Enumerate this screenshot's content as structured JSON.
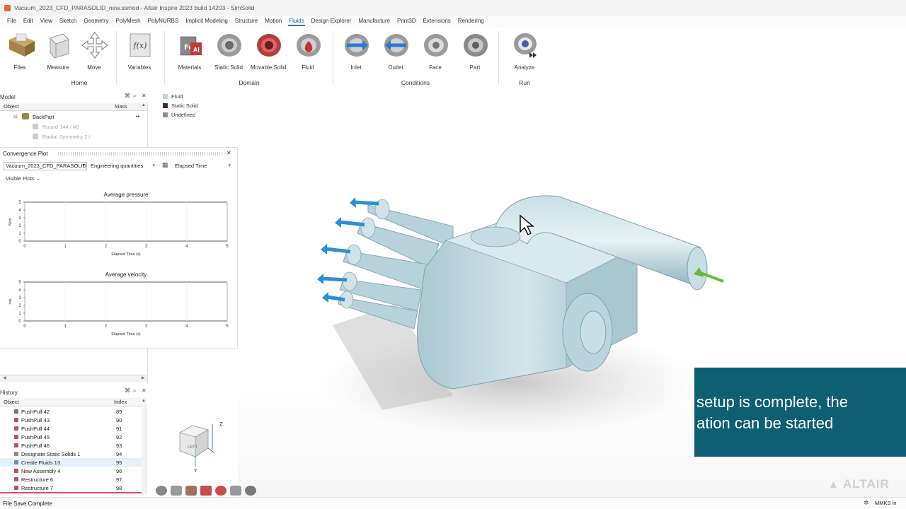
{
  "window": {
    "title": "Vacuum_2023_CFD_PARASOLID_new.ssmod - Altair Inspire 2023 build 14203 - SimSolid"
  },
  "menu": [
    "File",
    "Edit",
    "View",
    "Sketch",
    "Geometry",
    "PolyMesh",
    "PolyNURBS",
    "Implicit Modeling",
    "Structure",
    "Motion",
    "Fluids",
    "Design Explorer",
    "Manufacture",
    "Print3D",
    "Extensions",
    "Rendering"
  ],
  "ribbon": {
    "tools": {
      "files": "Files",
      "measure": "Measure",
      "move": "Move",
      "variables": "Variables",
      "materials": "Materials",
      "static_solid": "Static Solid",
      "movable_solid": "Movable Solid",
      "fluid": "Fluid",
      "inlet": "Inlet",
      "outlet": "Outlet",
      "face": "Face",
      "part": "Part",
      "analyze": "Analyze"
    },
    "groups": {
      "home": "Home",
      "domain": "Domain",
      "conditions": "Conditions",
      "run": "Run"
    }
  },
  "model_panel": {
    "title": "Model",
    "col_object": "Object",
    "col_mass": "Mass",
    "items": [
      "BackPart",
      "Round 144 / #0",
      "Radial Symmetry 2 /"
    ]
  },
  "legend": [
    {
      "label": "Fluid",
      "color": "#bcd6e4"
    },
    {
      "label": "Static Solid",
      "color": "#333333"
    },
    {
      "label": "Undefined",
      "color": "#8e8e8e"
    }
  ],
  "convergence": {
    "title": "Convergence Plot",
    "study": "Vacuum_2023_CFD_PARASOLID",
    "quantities": "Engineering quantities",
    "time": "Elapsed Time",
    "visible_plots": "Visible Plots"
  },
  "chart_data": [
    {
      "type": "line",
      "title": "Average pressure",
      "xlabel": "Elapsed Time (s)",
      "ylabel": "N/m²",
      "xlim": [
        0,
        5
      ],
      "ylim": [
        0,
        5
      ],
      "x_ticks": [
        "0",
        "1",
        "2",
        "3",
        "4",
        "5"
      ],
      "y_ticks": [
        "0",
        "1",
        "2",
        "3",
        "4",
        "5"
      ],
      "series": []
    },
    {
      "type": "line",
      "title": "Average velocity",
      "xlabel": "Elapsed Time (s)",
      "ylabel": "m/s",
      "xlim": [
        0,
        5
      ],
      "ylim": [
        0,
        5
      ],
      "x_ticks": [
        "0",
        "1",
        "2",
        "3",
        "4",
        "5"
      ],
      "y_ticks": [
        "0",
        "1",
        "2",
        "3",
        "4",
        "5"
      ],
      "series": []
    }
  ],
  "history": {
    "title": "History",
    "col_object": "Object",
    "col_index": "Index",
    "rows": [
      {
        "name": "PushPull 42",
        "index": "89"
      },
      {
        "name": "PushPull 43",
        "index": "90"
      },
      {
        "name": "PushPull 44",
        "index": "91"
      },
      {
        "name": "PushPull 45",
        "index": "92"
      },
      {
        "name": "PushPull 46",
        "index": "93"
      },
      {
        "name": "Designate Static Solids 1",
        "index": "94"
      },
      {
        "name": "Create Fluids 13",
        "index": "95"
      },
      {
        "name": "New Assembly 4",
        "index": "96"
      },
      {
        "name": "Restructure 6",
        "index": "97"
      },
      {
        "name": "Restructure 7",
        "index": "98"
      }
    ]
  },
  "viewcube": {
    "face": "LEFT",
    "axis_z": "Z",
    "axis_y": "Y"
  },
  "caption": {
    "line1": "setup is complete, the",
    "line2": "ation can be started"
  },
  "watermark": "ALTAIR",
  "status": {
    "message": "File Save Complete",
    "units": "MMKS in"
  }
}
